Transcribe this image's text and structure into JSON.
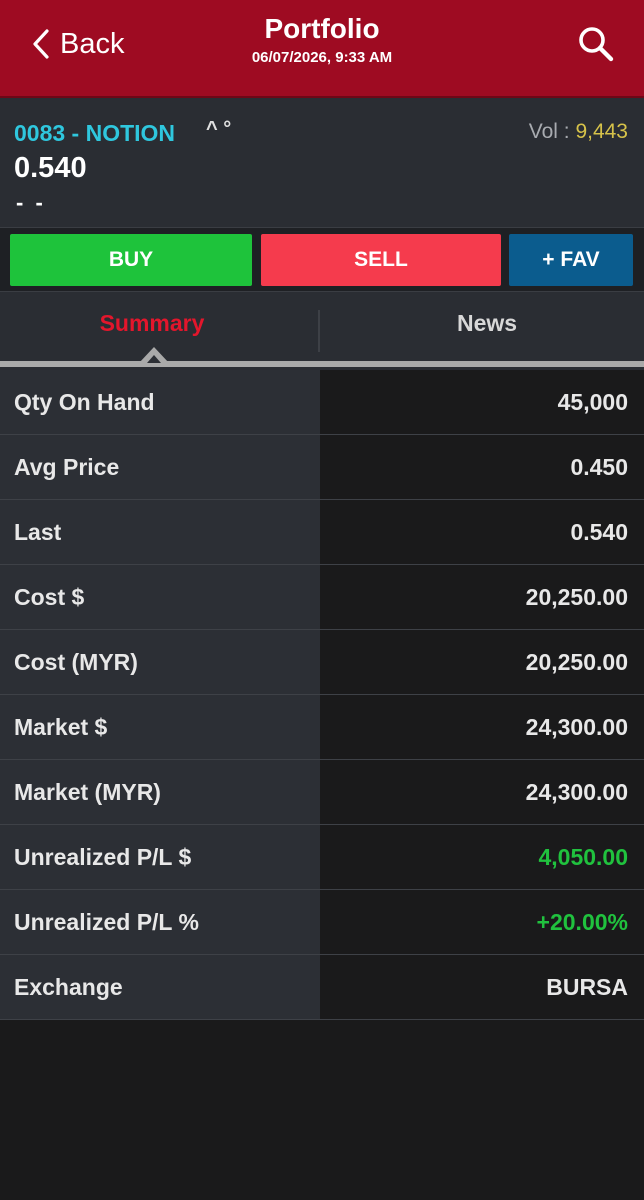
{
  "header": {
    "back_label": "Back",
    "title": "Portfolio",
    "datetime": "06/07/2026, 9:33 AM",
    "background_color": "#9e0b22"
  },
  "stock": {
    "name": "0083 - NOTION",
    "flags": "^ °",
    "vol_label": "Vol :",
    "vol_value": "9,443",
    "price": "0.540",
    "change": "- -"
  },
  "actions": {
    "buy_label": "BUY",
    "sell_label": "SELL",
    "fav_label": "+ FAV",
    "buy_color": "#1ec33b",
    "sell_color": "#f53b4d",
    "fav_color": "#0b5c8e"
  },
  "tabs": {
    "summary_label": "Summary",
    "news_label": "News",
    "active": "Summary"
  },
  "summary": {
    "rows": [
      {
        "label": "Qty On Hand",
        "value": "45,000"
      },
      {
        "label": "Avg Price",
        "value": "0.450"
      },
      {
        "label": "Last",
        "value": "0.540"
      },
      {
        "label": "Cost $",
        "value": "20,250.00"
      },
      {
        "label": "Cost (MYR)",
        "value": "20,250.00"
      },
      {
        "label": "Market $",
        "value": "24,300.00"
      },
      {
        "label": "Market (MYR)",
        "value": "24,300.00"
      },
      {
        "label": "Unrealized P/L $",
        "value": "4,050.00"
      },
      {
        "label": "Unrealized P/L %",
        "value": "+20.00%"
      },
      {
        "label": "Exchange",
        "value": "BURSA"
      }
    ]
  },
  "icons": {
    "back": "chevron-left-icon",
    "search": "search-icon"
  }
}
